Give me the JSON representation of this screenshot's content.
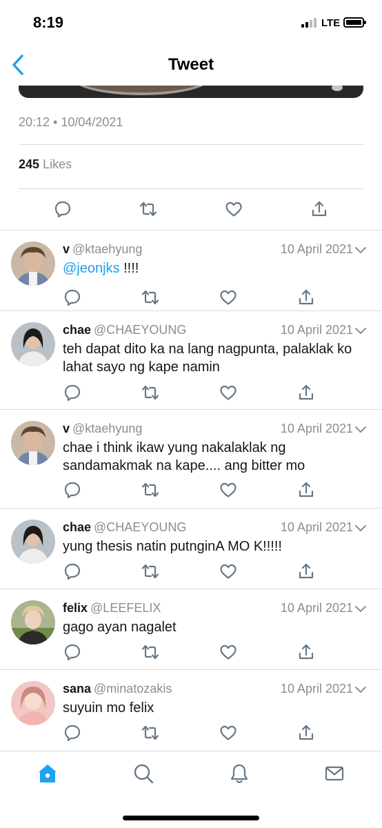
{
  "status_bar": {
    "time": "8:19",
    "network": "LTE"
  },
  "nav": {
    "title": "Tweet"
  },
  "tweet": {
    "timestamp": "20:12 • 10/04/2021",
    "likes_count": "245",
    "likes_label": "Likes"
  },
  "replies": [
    {
      "name": "v",
      "handle": "@ktaehyung",
      "date": "10 April 2021",
      "mention": "@jeonjks",
      "text": " !!!!"
    },
    {
      "name": "chae",
      "handle": "@CHAEYOUNG",
      "date": "10 April 2021",
      "mention": "",
      "text": "teh dapat dito ka na lang nagpunta, palaklak ko lahat sayo ng kape namin"
    },
    {
      "name": "v",
      "handle": "@ktaehyung",
      "date": "10 April 2021",
      "mention": "",
      "text": "chae i think ikaw yung nakalaklak ng sandamakmak na kape.... ang bitter mo"
    },
    {
      "name": "chae",
      "handle": "@CHAEYOUNG",
      "date": "10 April 2021",
      "mention": "",
      "text": "yung thesis natin putnginA MO K!!!!!"
    },
    {
      "name": "felix",
      "handle": "@LEEFELIX",
      "date": "10 April 2021",
      "mention": "",
      "text": "gago ayan nagalet"
    },
    {
      "name": "sana",
      "handle": "@minatozakis",
      "date": "10 April 2021",
      "mention": "",
      "text": "suyuin mo felix"
    }
  ],
  "tabs": [
    "home-icon",
    "search-icon",
    "notifications-icon",
    "messages-icon"
  ],
  "colors": {
    "accent": "#1da1f2",
    "icon": "#657786",
    "secondary_text": "#8a8d91",
    "divider": "#d7dadd"
  }
}
